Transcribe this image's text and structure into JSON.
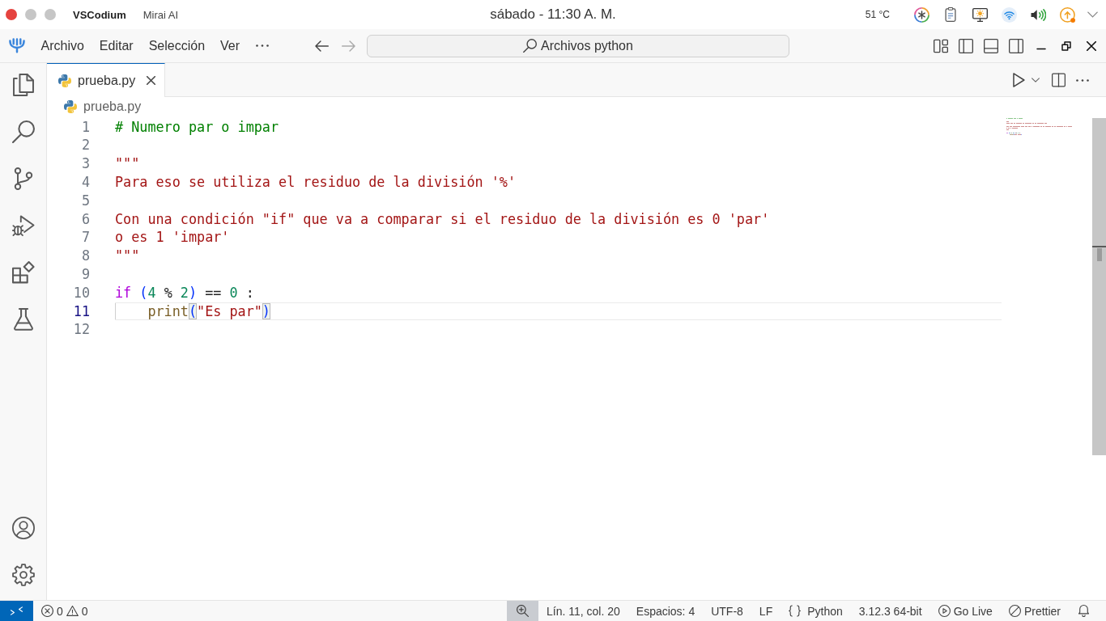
{
  "system_bar": {
    "app_name": "VSCodium",
    "window_title": "Mirai AI",
    "clock": "sábado - 11:30 A. M.",
    "temperature": "51 °C"
  },
  "menu_bar": {
    "items": [
      "Archivo",
      "Editar",
      "Selección",
      "Ver"
    ],
    "command_center": "Archivos python"
  },
  "tabs": [
    {
      "label": "prueba.py",
      "selected": true
    }
  ],
  "breadcrumb": [
    "prueba.py"
  ],
  "editor": {
    "lines": [
      {
        "number": "1",
        "current": false,
        "indent_guide": false,
        "tokens": [
          {
            "kind": "comment",
            "text": "# Numero par o impar"
          }
        ]
      },
      {
        "number": "2",
        "current": false,
        "indent_guide": false
      },
      {
        "number": "3",
        "current": false,
        "indent_guide": false,
        "tokens": [
          {
            "kind": "string",
            "text": "\"\"\""
          }
        ]
      },
      {
        "number": "4",
        "current": false,
        "indent_guide": false,
        "tokens": [
          {
            "kind": "string",
            "text": "Para eso se utiliza el residuo de la división '%'"
          }
        ]
      },
      {
        "number": "5",
        "current": false,
        "indent_guide": false
      },
      {
        "number": "6",
        "current": false,
        "indent_guide": false,
        "tokens": [
          {
            "kind": "string",
            "text": "Con una condición \"if\" que va a comparar si el residuo de la división es 0 'par'"
          }
        ]
      },
      {
        "number": "7",
        "current": false,
        "indent_guide": false,
        "tokens": [
          {
            "kind": "string",
            "text": "o es 1 'impar'"
          }
        ]
      },
      {
        "number": "8",
        "current": false,
        "indent_guide": false,
        "tokens": [
          {
            "kind": "string",
            "text": "\"\"\""
          }
        ]
      },
      {
        "number": "9",
        "current": false,
        "indent_guide": false
      },
      {
        "number": "10",
        "current": false,
        "indent_guide": false,
        "tokens": [
          {
            "kind": "keyword",
            "text": "if "
          },
          {
            "kind": "bracket",
            "text": "("
          },
          {
            "kind": "number",
            "text": "4"
          },
          {
            "kind": "plain",
            "text": " % "
          },
          {
            "kind": "number",
            "text": "2"
          },
          {
            "kind": "bracket",
            "text": ")"
          },
          {
            "kind": "plain",
            "text": " == "
          },
          {
            "kind": "number",
            "text": "0"
          },
          {
            "kind": "plain",
            "text": " :"
          }
        ]
      },
      {
        "number": "11",
        "current": true,
        "indent_guide": true,
        "tokens": [
          {
            "kind": "function",
            "text": "print"
          },
          {
            "kind": "bracket_matched",
            "text": "("
          },
          {
            "kind": "string",
            "text": "\"Es par\""
          },
          {
            "kind": "bracket_matched",
            "text": ")"
          }
        ]
      },
      {
        "number": "12",
        "current": false,
        "indent_guide": false
      }
    ]
  },
  "status_bar": {
    "errors": "0",
    "warnings": "0",
    "items": [
      {
        "kind": "text",
        "label": "Lín. 11, col. 20"
      },
      {
        "kind": "text",
        "label": "Espacios: 4"
      },
      {
        "kind": "text",
        "label": "UTF-8"
      },
      {
        "kind": "text",
        "label": "LF"
      },
      {
        "kind": "language",
        "label": "Python"
      },
      {
        "kind": "text",
        "label": "3.12.3 64-bit"
      },
      {
        "kind": "live",
        "label": "Go Live"
      },
      {
        "kind": "formatter",
        "label": "Prettier"
      }
    ]
  }
}
